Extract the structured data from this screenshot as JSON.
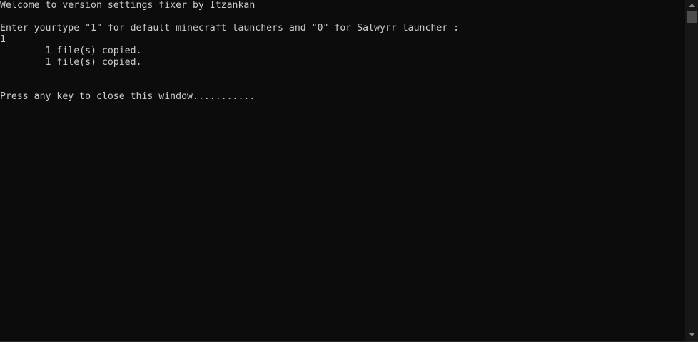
{
  "console": {
    "lines": [
      "Welcome to version settings fixer by Itzankan",
      "",
      "Enter yourtype \"1\" for default minecraft launchers and \"0\" for Salwyrr launcher :",
      "1",
      "        1 file(s) copied.",
      "        1 file(s) copied.",
      "",
      "",
      "Press any key to close this window..........."
    ]
  },
  "scrollbar": {
    "up_icon": "triangle-up-icon",
    "down_icon": "triangle-down-icon"
  },
  "colors": {
    "background": "#0c0c0c",
    "text": "#cccccc",
    "scrollbar_track": "#171717",
    "scrollbar_thumb": "#4d4d4d"
  }
}
